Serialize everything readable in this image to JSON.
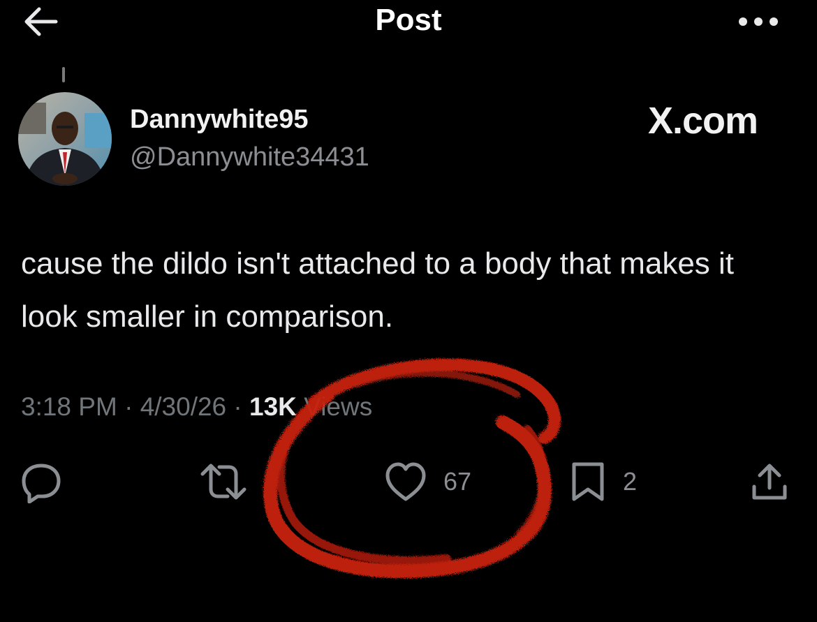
{
  "header": {
    "title": "Post",
    "back_icon": "arrow-left-icon",
    "more_icon": "more-dots-icon"
  },
  "author": {
    "display_name": "Dannywhite95",
    "handle": "@Dannywhite34431"
  },
  "watermark": "X.com",
  "post": {
    "text": "cause the dildo isn't attached to a body that makes it look smaller in comparison.",
    "time": "3:18 PM",
    "date": "4/30/26",
    "views_count": "13K",
    "views_label": "Views"
  },
  "actions": {
    "reply": {
      "icon": "reply-icon",
      "count": ""
    },
    "repost": {
      "icon": "repost-icon",
      "count": ""
    },
    "like": {
      "icon": "heart-icon",
      "count": "67"
    },
    "bookmark": {
      "icon": "bookmark-icon",
      "count": "2"
    },
    "share": {
      "icon": "share-icon"
    }
  },
  "colors": {
    "background": "#000000",
    "text": "#e7e9ea",
    "secondary": "#71767b",
    "annotation": "#c8210f"
  }
}
